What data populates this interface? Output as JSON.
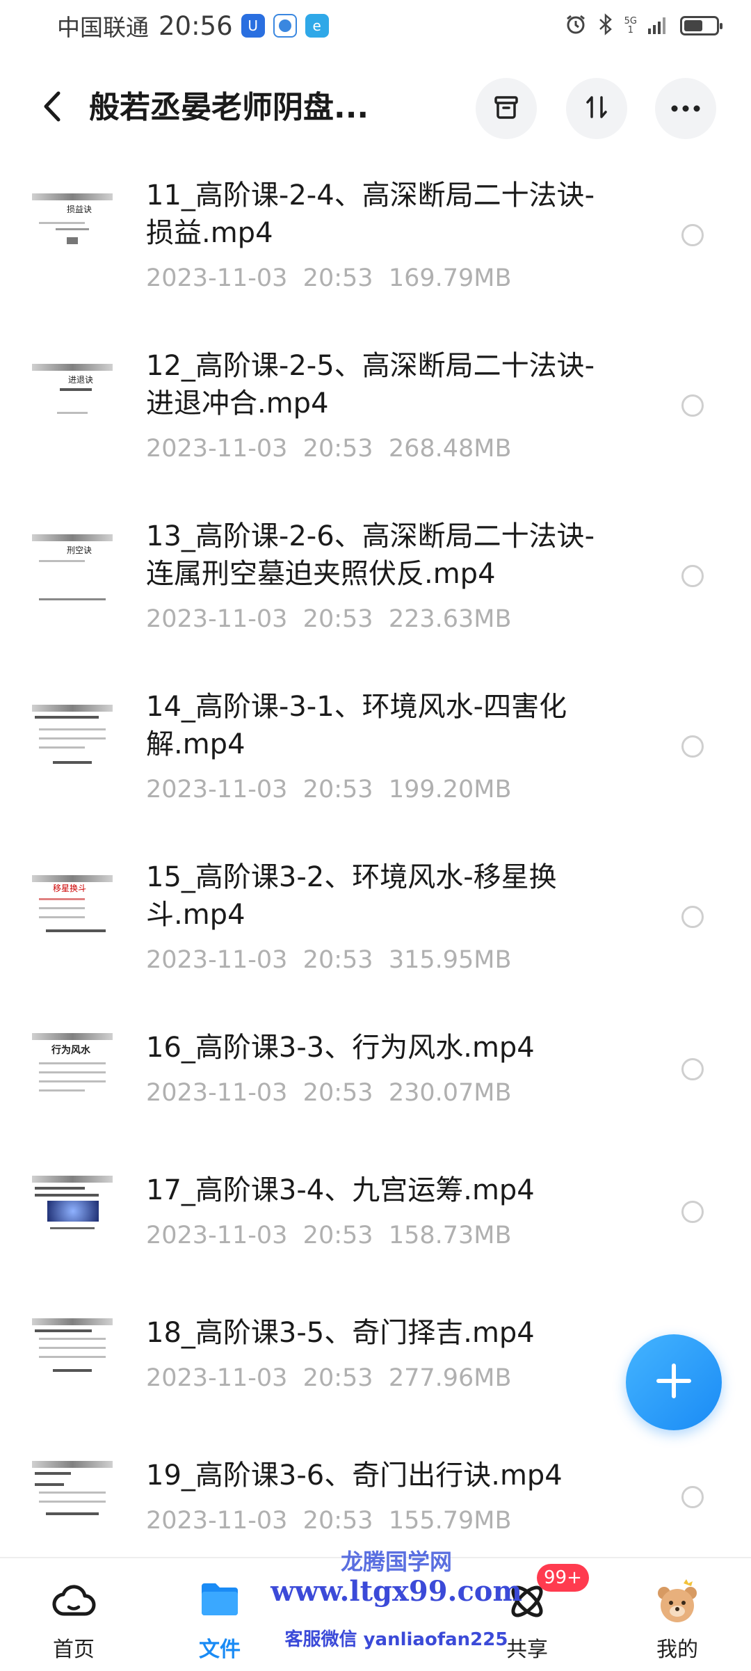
{
  "status_bar": {
    "carrier": "中国联通",
    "time": "20:56",
    "network": "5G",
    "icons": [
      "shield-app-icon",
      "browser-app-icon",
      "e-app-icon",
      "alarm-icon",
      "bluetooth-icon",
      "signal-icon",
      "battery-icon"
    ]
  },
  "header": {
    "title": "般若丞晏老师阴盘...",
    "back_icon": "chevron-left-icon",
    "actions": [
      "archive-icon",
      "sort-icon",
      "more-icon"
    ]
  },
  "files": [
    {
      "name": "11_高阶课-2-4、高深断局二十法诀-损益.mp4",
      "date": "2023-11-03",
      "time": "20:53",
      "size": "169.79MB",
      "thumb_text": "损益诀"
    },
    {
      "name": "12_高阶课-2-5、高深断局二十法诀-进退冲合.mp4",
      "date": "2023-11-03",
      "time": "20:53",
      "size": "268.48MB",
      "thumb_text": "进退诀"
    },
    {
      "name": "13_高阶课-2-6、高深断局二十法诀-连属刑空墓迫夹照伏反.mp4",
      "date": "2023-11-03",
      "time": "20:53",
      "size": "223.63MB",
      "thumb_text": "刑空诀"
    },
    {
      "name": "14_高阶课-3-1、环境风水-四害化解.mp4",
      "date": "2023-11-03",
      "time": "20:53",
      "size": "199.20MB",
      "thumb_text": ""
    },
    {
      "name": "15_高阶课3-2、环境风水-移星换斗.mp4",
      "date": "2023-11-03",
      "time": "20:53",
      "size": "315.95MB",
      "thumb_text": "移星换斗"
    },
    {
      "name": "16_高阶课3-3、行为风水.mp4",
      "date": "2023-11-03",
      "time": "20:53",
      "size": "230.07MB",
      "thumb_text": "行为风水"
    },
    {
      "name": "17_高阶课3-4、九宫运筹.mp4",
      "date": "2023-11-03",
      "time": "20:53",
      "size": "158.73MB",
      "thumb_text": ""
    },
    {
      "name": "18_高阶课3-5、奇门择吉.mp4",
      "date": "2023-11-03",
      "time": "20:53",
      "size": "277.96MB",
      "thumb_text": ""
    },
    {
      "name": "19_高阶课3-6、奇门出行诀.mp4",
      "date": "2023-11-03",
      "time": "20:53",
      "size": "155.79MB",
      "thumb_text": ""
    }
  ],
  "fab": {
    "icon": "plus-icon"
  },
  "bottom_nav": [
    {
      "label": "首页",
      "icon": "cloud-icon",
      "active": false
    },
    {
      "label": "文件",
      "icon": "folder-icon",
      "active": true
    },
    {
      "label": "",
      "icon": "",
      "active": false
    },
    {
      "label": "共享",
      "icon": "atom-icon",
      "active": false,
      "badge": "99+"
    },
    {
      "label": "我的",
      "icon": "bear-avatar-icon",
      "active": false
    }
  ],
  "watermark": {
    "line1": "龙腾国学网",
    "line2": "www.ltgx99.com",
    "line3": "客服微信 yanliaofan225"
  },
  "colors": {
    "accent": "#1a8bf5",
    "badge": "#ff3b4f",
    "meta_text": "#b0b0b0"
  }
}
